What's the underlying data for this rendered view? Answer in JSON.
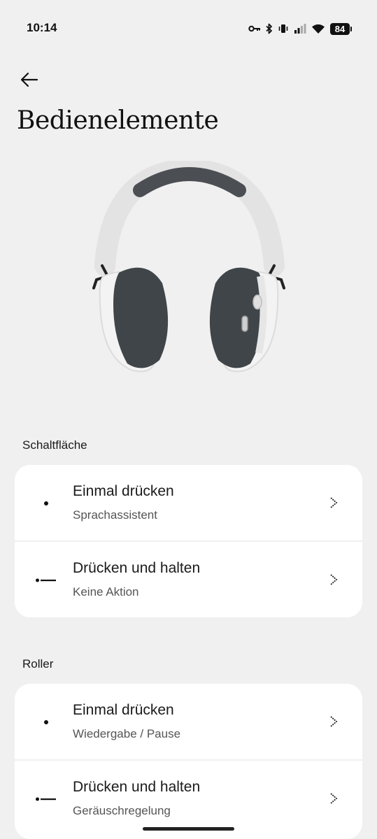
{
  "status_bar": {
    "time": "10:14",
    "battery": "84",
    "icons": [
      "key-icon",
      "bluetooth-icon",
      "vibrate-icon",
      "signal-icon",
      "wifi-icon",
      "battery-icon"
    ]
  },
  "header": {
    "back_icon": "arrow-left-icon",
    "title": "Bedienelemente"
  },
  "image": {
    "subject": "headphones"
  },
  "sections": [
    {
      "label": "Schaltfläche",
      "rows": [
        {
          "title": "Einmal drücken",
          "subtitle": "Sprachassistent",
          "icon": "single-press-icon"
        },
        {
          "title": "Drücken und halten",
          "subtitle": "Keine Aktion",
          "icon": "press-hold-icon"
        }
      ]
    },
    {
      "label": "Roller",
      "rows": [
        {
          "title": "Einmal drücken",
          "subtitle": "Wiedergabe / Pause",
          "icon": "single-press-icon"
        },
        {
          "title": "Drücken und halten",
          "subtitle": "Geräuschregelung",
          "icon": "press-hold-icon"
        }
      ]
    }
  ],
  "colors": {
    "background": "#f0f0f0",
    "card": "#ffffff",
    "text": "#1a1a1a",
    "subtext": "#555555"
  }
}
